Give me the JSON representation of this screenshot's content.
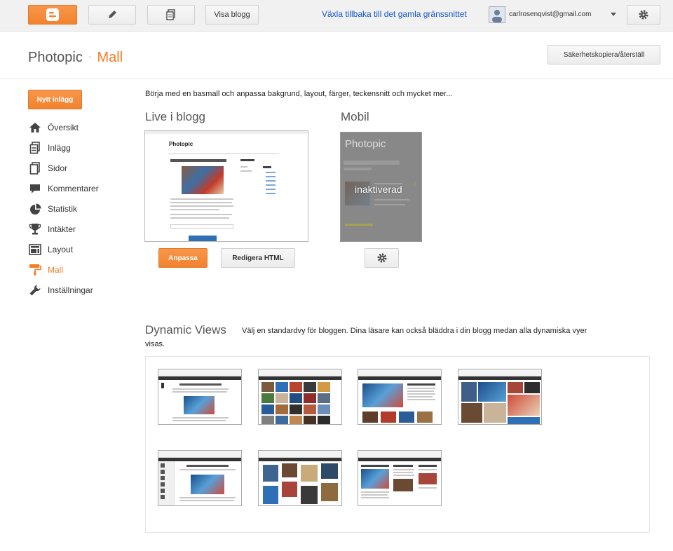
{
  "topbar": {
    "new_post_icon": "pencil-icon",
    "view_blog_label": "Visa blogg",
    "switch_link": "Växla tillbaka till det gamla gränssnittet",
    "account_email": "carlrosenqvist@gmail.com"
  },
  "header": {
    "blog_name": "Photopic",
    "separator": "·",
    "current_section": "Mall",
    "backup_label": "Säkerhetskopiera/återställ"
  },
  "sidebar": {
    "new_post_label": "Nytt inlägg",
    "items": [
      {
        "label": "Översikt",
        "icon": "home-icon"
      },
      {
        "label": "Inlägg",
        "icon": "posts-icon"
      },
      {
        "label": "Sidor",
        "icon": "pages-icon"
      },
      {
        "label": "Kommentarer",
        "icon": "comments-icon"
      },
      {
        "label": "Statistik",
        "icon": "stats-icon"
      },
      {
        "label": "Intäkter",
        "icon": "trophy-icon"
      },
      {
        "label": "Layout",
        "icon": "layout-icon"
      },
      {
        "label": "Mall",
        "icon": "template-icon"
      },
      {
        "label": "Inställningar",
        "icon": "wrench-icon"
      }
    ]
  },
  "main": {
    "intro": "Börja med en basmall och anpassa bakgrund, layout, färger, teckensnitt och mycket mer...",
    "live_title": "Live i blogg",
    "live_preview_title": "Photopic",
    "customize_label": "Anpassa",
    "edit_html_label": "Redigera HTML",
    "mobile_title": "Mobil",
    "mobile_preview_title": "Photopic",
    "mobile_overlay": "inaktiverad",
    "dynamic_title": "Dynamic Views",
    "dynamic_desc_1": "Välj en standardvy för bloggen. Dina läsare kan också bläddra i din blogg medan alla dynamiska vyer",
    "dynamic_desc_2": "visas."
  },
  "colors": {
    "accent": "#f57d28",
    "link": "#1155cc"
  }
}
